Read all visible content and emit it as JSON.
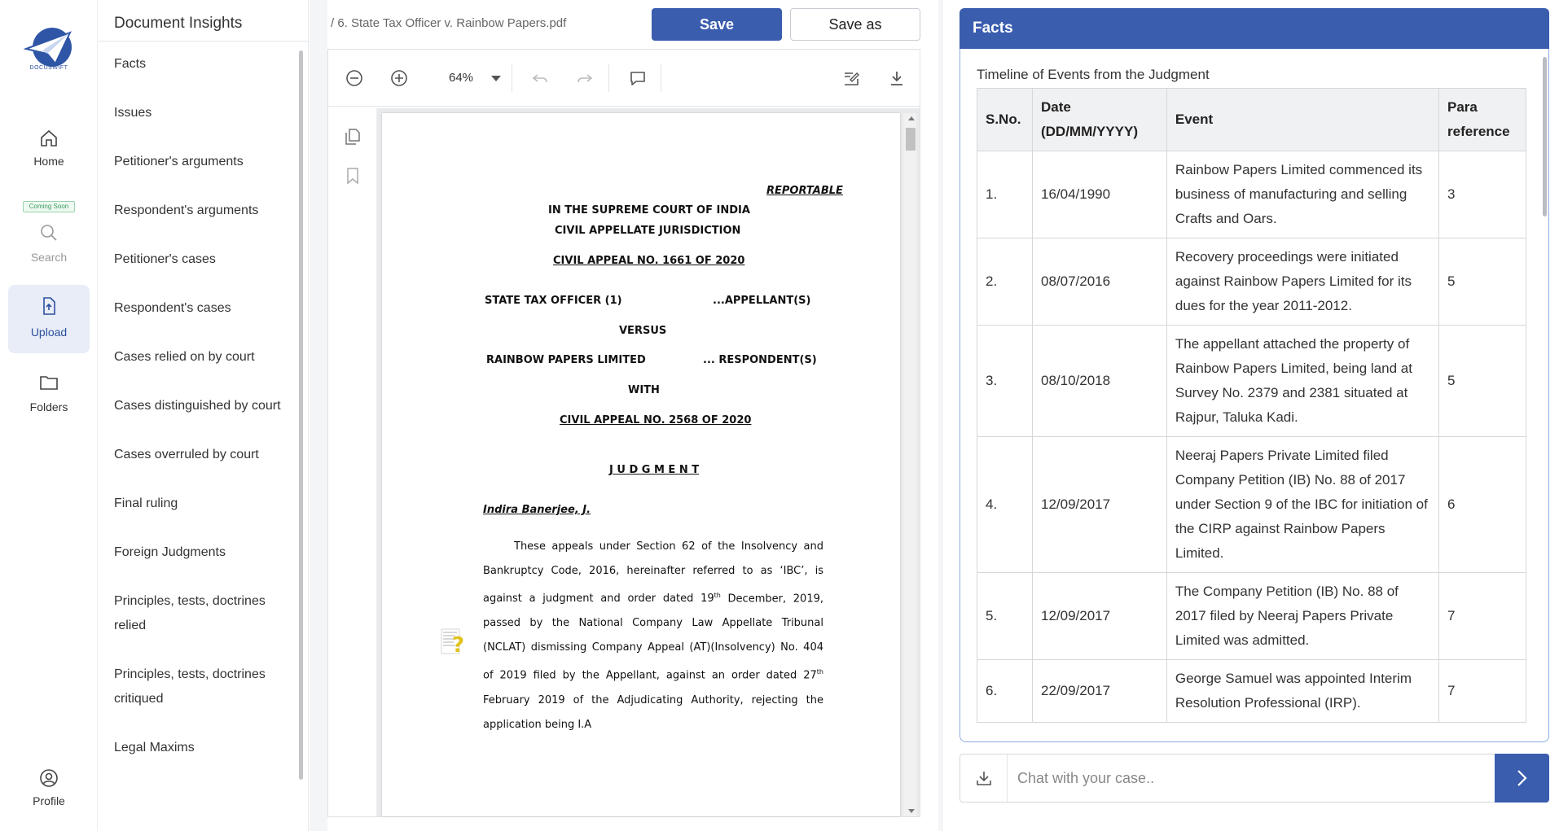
{
  "app": {
    "logo_text": "DOCUSWIFT"
  },
  "nav": {
    "home": "Home",
    "coming_soon": "Coming Soon",
    "search": "Search",
    "upload": "Upload",
    "folders": "Folders",
    "profile": "Profile"
  },
  "insights": {
    "title": "Document Insights",
    "items": [
      "Facts",
      "Issues",
      "Petitioner's arguments",
      "Respondent's arguments",
      "Petitioner's cases",
      "Respondent's cases",
      "Cases relied on by court",
      "Cases distinguished by court",
      "Cases overruled by court",
      "Final ruling",
      "Foreign Judgments",
      "Principles, tests, doctrines relied",
      "Principles, tests, doctrines critiqued",
      "Legal Maxims"
    ]
  },
  "doc": {
    "breadcrumb": "/ 6. State Tax Officer v. Rainbow Papers.pdf",
    "save_label": "Save",
    "save_as_label": "Save as",
    "zoom": "64%"
  },
  "page": {
    "reportable": "REPORTABLE",
    "court": "IN THE SUPREME COURT OF INDIA",
    "jurisdiction": "CIVIL APPELLATE JURISDICTION",
    "appeal1": "CIVIL APPEAL NO. 1661 OF 2020",
    "appellant": "STATE TAX OFFICER (1)",
    "appellant_role": "...APPELLANT(S)",
    "versus": "VERSUS",
    "respondent": "RAINBOW PAPERS LIMITED",
    "respondent_role": "... RESPONDENT(S)",
    "with": "WITH",
    "appeal2": "CIVIL APPEAL NO. 2568 OF 2020",
    "judgment": "J U D G M E N T",
    "judge": "Indira Banerjee, J.",
    "para1": "These appeals under Section 62 of the Insolvency and Bankruptcy Code, 2016, hereinafter referred to as ‘IBC’, is against a judgment and order dated 19",
    "para1_sup": "th",
    "para1b": " December, 2019, passed by the National Company Law Appellate Tribunal (NCLAT) dismissing Company Appeal (AT)(Insolvency) No. 404 of 2019 filed by the Appellant, against an order dated 27",
    "para1b_sup": "th",
    "para1c": " February 2019 of the Adjudicating Authority, rejecting the application being I.A"
  },
  "facts": {
    "header": "Facts",
    "subtitle": "Timeline of Events from the Judgment",
    "columns": [
      "S.No.",
      "Date (DD/MM/YYYY)",
      "Event",
      "Para reference"
    ],
    "rows": [
      {
        "sno": "1.",
        "date": "16/04/1990",
        "event": "Rainbow Papers Limited commenced its business of manufacturing and selling Crafts and Oars.",
        "para": "3"
      },
      {
        "sno": "2.",
        "date": "08/07/2016",
        "event": "Recovery proceedings were initiated against Rainbow Papers Limited for its dues for the year 2011-2012.",
        "para": "5"
      },
      {
        "sno": "3.",
        "date": "08/10/2018",
        "event": "The appellant attached the property of Rainbow Papers Limited, being land at Survey No. 2379 and 2381 situated at Rajpur, Taluka Kadi.",
        "para": "5"
      },
      {
        "sno": "4.",
        "date": "12/09/2017",
        "event": "Neeraj Papers Private Limited filed Company Petition (IB) No. 88 of 2017 under Section 9 of the IBC for initiation of the CIRP against Rainbow Papers Limited.",
        "para": "6"
      },
      {
        "sno": "5.",
        "date": "12/09/2017",
        "event": "The Company Petition (IB) No. 88 of 2017 filed by Neeraj Papers Private Limited was admitted.",
        "para": "7"
      },
      {
        "sno": "6.",
        "date": "22/09/2017",
        "event": "George Samuel was appointed Interim Resolution Professional (IRP).",
        "para": "7"
      }
    ]
  },
  "chat": {
    "placeholder": "Chat with your case.."
  },
  "colors": {
    "accent": "#3a5dae",
    "active_nav_bg": "#e8edf7"
  }
}
